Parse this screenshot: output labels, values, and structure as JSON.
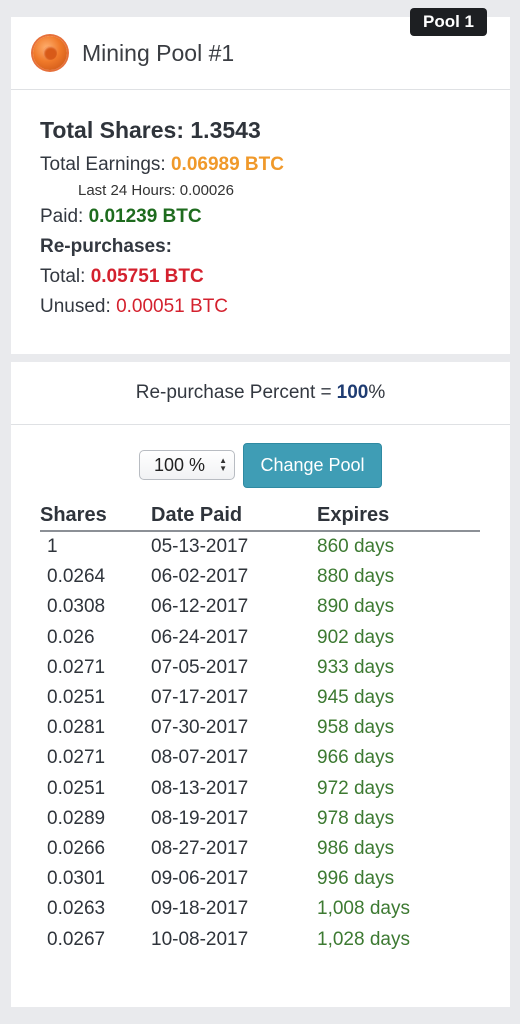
{
  "badge": {
    "label": "Pool 1"
  },
  "header": {
    "title": "Mining Pool #1"
  },
  "stats": {
    "total_shares_label": "Total Shares:",
    "total_shares_value": "1.3543",
    "total_earnings_label": "Total Earnings:",
    "total_earnings_value": "0.06989 BTC",
    "last24_label": "Last 24 Hours:",
    "last24_value": "0.00026",
    "paid_label": "Paid:",
    "paid_value": "0.01239 BTC",
    "repurchases_label": "Re-purchases:",
    "total_label": "Total:",
    "total_value": "0.05751 BTC",
    "unused_label": "Unused:",
    "unused_value": "0.00051 BTC"
  },
  "repurchase": {
    "label": "Re-purchase Percent =",
    "value": "100",
    "suffix": "%"
  },
  "controls": {
    "select_value": "100 %",
    "change_button": "Change Pool"
  },
  "table": {
    "headers": [
      "Shares",
      "Date Paid",
      "Expires"
    ],
    "rows": [
      [
        "1",
        "05-13-2017",
        "860 days"
      ],
      [
        "0.0264",
        "06-02-2017",
        "880 days"
      ],
      [
        "0.0308",
        "06-12-2017",
        "890 days"
      ],
      [
        "0.026",
        "06-24-2017",
        "902 days"
      ],
      [
        "0.0271",
        "07-05-2017",
        "933 days"
      ],
      [
        "0.0251",
        "07-17-2017",
        "945 days"
      ],
      [
        "0.0281",
        "07-30-2017",
        "958 days"
      ],
      [
        "0.0271",
        "08-07-2017",
        "966 days"
      ],
      [
        "0.0251",
        "08-13-2017",
        "972 days"
      ],
      [
        "0.0289",
        "08-19-2017",
        "978 days"
      ],
      [
        "0.0266",
        "08-27-2017",
        "986 days"
      ],
      [
        "0.0301",
        "09-06-2017",
        "996 days"
      ],
      [
        "0.0263",
        "09-18-2017",
        "1,008 days"
      ],
      [
        "0.0267",
        "10-08-2017",
        "1,028 days"
      ]
    ]
  },
  "colors": {
    "earnings": "#f0992a",
    "paid": "#1e6b1e",
    "repurchase": "#d4212e",
    "expires": "#3d7a32",
    "button": "#3f9db5",
    "badge": "#1d1f22"
  },
  "icons": {
    "pool": "mining-coin-icon"
  }
}
